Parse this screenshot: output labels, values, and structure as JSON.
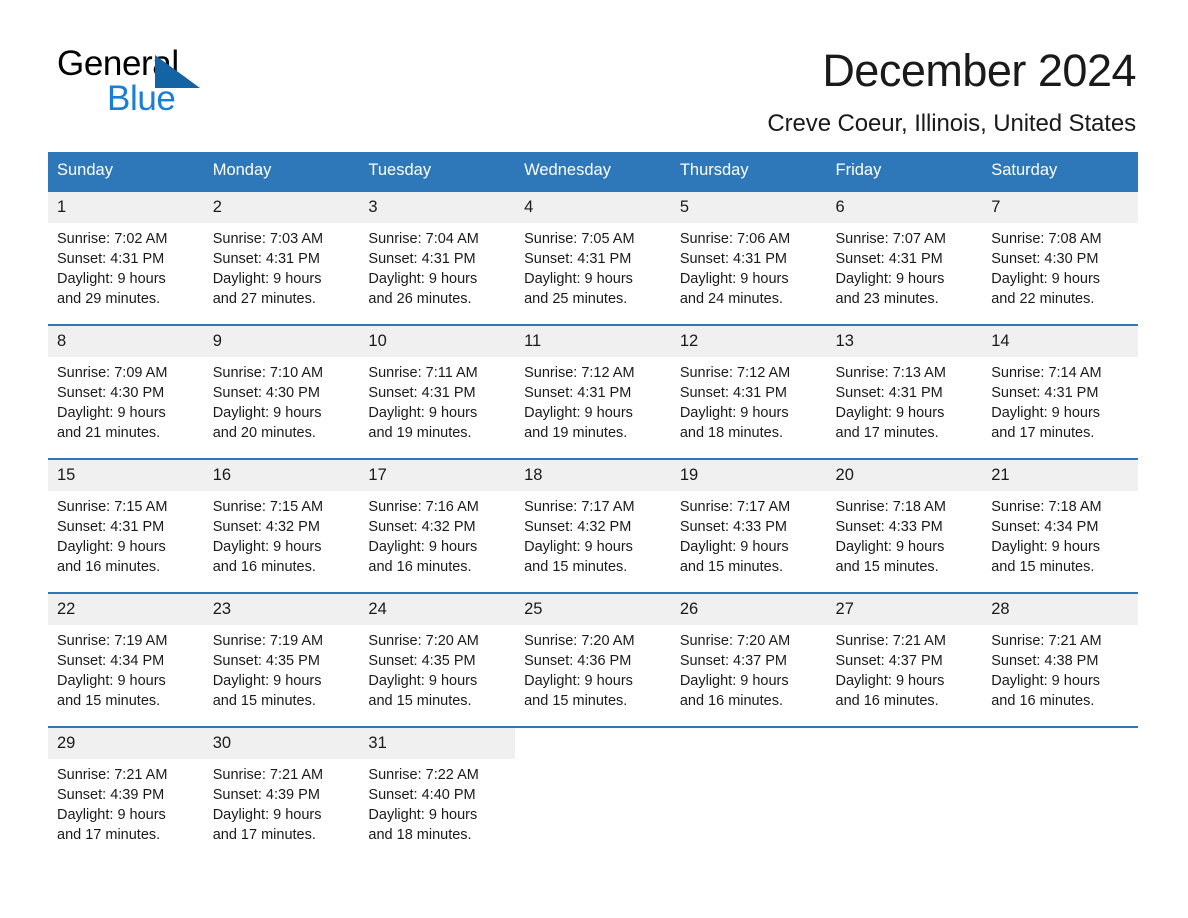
{
  "brand": {
    "name_part1": "General",
    "name_part2": "Blue",
    "accent_color": "#1a7fd4",
    "triangle_color": "#1464a5"
  },
  "header": {
    "title": "December 2024",
    "subtitle": "Creve Coeur, Illinois, United States"
  },
  "calendar": {
    "header_color": "#2e77b8",
    "daynum_band_color": "#f0f0f0",
    "weekday_headers": [
      "Sunday",
      "Monday",
      "Tuesday",
      "Wednesday",
      "Thursday",
      "Friday",
      "Saturday"
    ],
    "weeks": [
      [
        {
          "day": "1",
          "sunrise": "Sunrise: 7:02 AM",
          "sunset": "Sunset: 4:31 PM",
          "daylight_line1": "Daylight: 9 hours",
          "daylight_line2": "and 29 minutes."
        },
        {
          "day": "2",
          "sunrise": "Sunrise: 7:03 AM",
          "sunset": "Sunset: 4:31 PM",
          "daylight_line1": "Daylight: 9 hours",
          "daylight_line2": "and 27 minutes."
        },
        {
          "day": "3",
          "sunrise": "Sunrise: 7:04 AM",
          "sunset": "Sunset: 4:31 PM",
          "daylight_line1": "Daylight: 9 hours",
          "daylight_line2": "and 26 minutes."
        },
        {
          "day": "4",
          "sunrise": "Sunrise: 7:05 AM",
          "sunset": "Sunset: 4:31 PM",
          "daylight_line1": "Daylight: 9 hours",
          "daylight_line2": "and 25 minutes."
        },
        {
          "day": "5",
          "sunrise": "Sunrise: 7:06 AM",
          "sunset": "Sunset: 4:31 PM",
          "daylight_line1": "Daylight: 9 hours",
          "daylight_line2": "and 24 minutes."
        },
        {
          "day": "6",
          "sunrise": "Sunrise: 7:07 AM",
          "sunset": "Sunset: 4:31 PM",
          "daylight_line1": "Daylight: 9 hours",
          "daylight_line2": "and 23 minutes."
        },
        {
          "day": "7",
          "sunrise": "Sunrise: 7:08 AM",
          "sunset": "Sunset: 4:30 PM",
          "daylight_line1": "Daylight: 9 hours",
          "daylight_line2": "and 22 minutes."
        }
      ],
      [
        {
          "day": "8",
          "sunrise": "Sunrise: 7:09 AM",
          "sunset": "Sunset: 4:30 PM",
          "daylight_line1": "Daylight: 9 hours",
          "daylight_line2": "and 21 minutes."
        },
        {
          "day": "9",
          "sunrise": "Sunrise: 7:10 AM",
          "sunset": "Sunset: 4:30 PM",
          "daylight_line1": "Daylight: 9 hours",
          "daylight_line2": "and 20 minutes."
        },
        {
          "day": "10",
          "sunrise": "Sunrise: 7:11 AM",
          "sunset": "Sunset: 4:31 PM",
          "daylight_line1": "Daylight: 9 hours",
          "daylight_line2": "and 19 minutes."
        },
        {
          "day": "11",
          "sunrise": "Sunrise: 7:12 AM",
          "sunset": "Sunset: 4:31 PM",
          "daylight_line1": "Daylight: 9 hours",
          "daylight_line2": "and 19 minutes."
        },
        {
          "day": "12",
          "sunrise": "Sunrise: 7:12 AM",
          "sunset": "Sunset: 4:31 PM",
          "daylight_line1": "Daylight: 9 hours",
          "daylight_line2": "and 18 minutes."
        },
        {
          "day": "13",
          "sunrise": "Sunrise: 7:13 AM",
          "sunset": "Sunset: 4:31 PM",
          "daylight_line1": "Daylight: 9 hours",
          "daylight_line2": "and 17 minutes."
        },
        {
          "day": "14",
          "sunrise": "Sunrise: 7:14 AM",
          "sunset": "Sunset: 4:31 PM",
          "daylight_line1": "Daylight: 9 hours",
          "daylight_line2": "and 17 minutes."
        }
      ],
      [
        {
          "day": "15",
          "sunrise": "Sunrise: 7:15 AM",
          "sunset": "Sunset: 4:31 PM",
          "daylight_line1": "Daylight: 9 hours",
          "daylight_line2": "and 16 minutes."
        },
        {
          "day": "16",
          "sunrise": "Sunrise: 7:15 AM",
          "sunset": "Sunset: 4:32 PM",
          "daylight_line1": "Daylight: 9 hours",
          "daylight_line2": "and 16 minutes."
        },
        {
          "day": "17",
          "sunrise": "Sunrise: 7:16 AM",
          "sunset": "Sunset: 4:32 PM",
          "daylight_line1": "Daylight: 9 hours",
          "daylight_line2": "and 16 minutes."
        },
        {
          "day": "18",
          "sunrise": "Sunrise: 7:17 AM",
          "sunset": "Sunset: 4:32 PM",
          "daylight_line1": "Daylight: 9 hours",
          "daylight_line2": "and 15 minutes."
        },
        {
          "day": "19",
          "sunrise": "Sunrise: 7:17 AM",
          "sunset": "Sunset: 4:33 PM",
          "daylight_line1": "Daylight: 9 hours",
          "daylight_line2": "and 15 minutes."
        },
        {
          "day": "20",
          "sunrise": "Sunrise: 7:18 AM",
          "sunset": "Sunset: 4:33 PM",
          "daylight_line1": "Daylight: 9 hours",
          "daylight_line2": "and 15 minutes."
        },
        {
          "day": "21",
          "sunrise": "Sunrise: 7:18 AM",
          "sunset": "Sunset: 4:34 PM",
          "daylight_line1": "Daylight: 9 hours",
          "daylight_line2": "and 15 minutes."
        }
      ],
      [
        {
          "day": "22",
          "sunrise": "Sunrise: 7:19 AM",
          "sunset": "Sunset: 4:34 PM",
          "daylight_line1": "Daylight: 9 hours",
          "daylight_line2": "and 15 minutes."
        },
        {
          "day": "23",
          "sunrise": "Sunrise: 7:19 AM",
          "sunset": "Sunset: 4:35 PM",
          "daylight_line1": "Daylight: 9 hours",
          "daylight_line2": "and 15 minutes."
        },
        {
          "day": "24",
          "sunrise": "Sunrise: 7:20 AM",
          "sunset": "Sunset: 4:35 PM",
          "daylight_line1": "Daylight: 9 hours",
          "daylight_line2": "and 15 minutes."
        },
        {
          "day": "25",
          "sunrise": "Sunrise: 7:20 AM",
          "sunset": "Sunset: 4:36 PM",
          "daylight_line1": "Daylight: 9 hours",
          "daylight_line2": "and 15 minutes."
        },
        {
          "day": "26",
          "sunrise": "Sunrise: 7:20 AM",
          "sunset": "Sunset: 4:37 PM",
          "daylight_line1": "Daylight: 9 hours",
          "daylight_line2": "and 16 minutes."
        },
        {
          "day": "27",
          "sunrise": "Sunrise: 7:21 AM",
          "sunset": "Sunset: 4:37 PM",
          "daylight_line1": "Daylight: 9 hours",
          "daylight_line2": "and 16 minutes."
        },
        {
          "day": "28",
          "sunrise": "Sunrise: 7:21 AM",
          "sunset": "Sunset: 4:38 PM",
          "daylight_line1": "Daylight: 9 hours",
          "daylight_line2": "and 16 minutes."
        }
      ],
      [
        {
          "day": "29",
          "sunrise": "Sunrise: 7:21 AM",
          "sunset": "Sunset: 4:39 PM",
          "daylight_line1": "Daylight: 9 hours",
          "daylight_line2": "and 17 minutes."
        },
        {
          "day": "30",
          "sunrise": "Sunrise: 7:21 AM",
          "sunset": "Sunset: 4:39 PM",
          "daylight_line1": "Daylight: 9 hours",
          "daylight_line2": "and 17 minutes."
        },
        {
          "day": "31",
          "sunrise": "Sunrise: 7:22 AM",
          "sunset": "Sunset: 4:40 PM",
          "daylight_line1": "Daylight: 9 hours",
          "daylight_line2": "and 18 minutes."
        },
        {
          "day": "",
          "sunrise": "",
          "sunset": "",
          "daylight_line1": "",
          "daylight_line2": ""
        },
        {
          "day": "",
          "sunrise": "",
          "sunset": "",
          "daylight_line1": "",
          "daylight_line2": ""
        },
        {
          "day": "",
          "sunrise": "",
          "sunset": "",
          "daylight_line1": "",
          "daylight_line2": ""
        },
        {
          "day": "",
          "sunrise": "",
          "sunset": "",
          "daylight_line1": "",
          "daylight_line2": ""
        }
      ]
    ]
  }
}
